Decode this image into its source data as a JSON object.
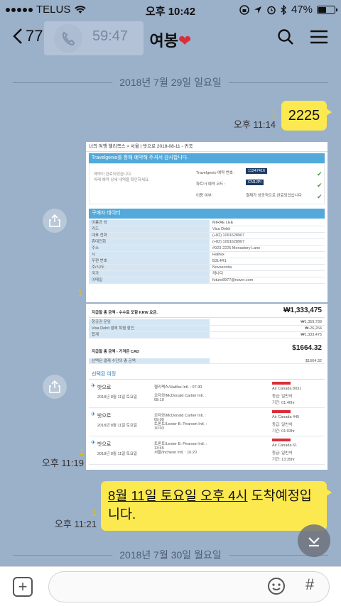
{
  "status_bar": {
    "carrier": "TELUS",
    "time": "오후 10:42",
    "battery": "47%",
    "battery_level": 0.47
  },
  "header": {
    "back_count": "77",
    "call_timer": "59:47",
    "title": "여봉",
    "title_emoji": "❤️"
  },
  "dates": {
    "first": "2018년 7월 29일 일요일",
    "second": "2018년 7월 30일 월요일"
  },
  "messages": [
    {
      "type": "text",
      "text": "2225",
      "time": "오후 11:14",
      "unread": "1"
    },
    {
      "type": "image",
      "unread": "1",
      "content": {
        "breadcrumb": "너의 여행 헬리콕스 > 서울 | 밧으로 2018-08-11 - 귀국",
        "thanks": "Travelgenio를 통해 예약해 주셔서 감사합니다.",
        "booking_id_label": "Travelgenio 예약 번호 :",
        "booking_id": "11247416",
        "airline_code_label": "파트너 예약 코드 :",
        "airline_code": "CN1JPI",
        "status_label": "이용 여부:",
        "status": "결제가 성공적으로 완료되었습니다",
        "buyer_title": "구매자 데이터",
        "buyer_rows": [
          {
            "k": "이름과 성",
            "v": "MIRAE LEE"
          },
          {
            "k": "카드",
            "v": "Visa Debit"
          },
          {
            "k": "대표 전화",
            "v": "(+82) 1091628907"
          },
          {
            "k": "휴대전화",
            "v": "(+82) 1091628907"
          },
          {
            "k": "주소",
            "v": "#923-2225 Monastery Lane"
          },
          {
            "k": "시",
            "v": "Halifax"
          },
          {
            "k": "우편 번호",
            "v": "B3L4R1"
          },
          {
            "k": "주/시/도",
            "v": "Novascotia"
          },
          {
            "k": "국가",
            "v": "캐나다"
          },
          {
            "k": "이메일",
            "v": "future8977@naver.com"
          }
        ]
      }
    },
    {
      "type": "image",
      "time": "오후 11:19",
      "unread": "1",
      "content": {
        "total_krw_label": "지급할 총 금액 - 수수료 포함 KRW 요금.",
        "total_krw": "₩1,333,475",
        "krw_rows": [
          {
            "k": "항공권 운임",
            "v": "₩1,359,739"
          },
          {
            "k": "Visa Debit 결제 특별 할인",
            "v": "₩-26,264"
          },
          {
            "k": "합계",
            "v": "₩1,333,475"
          }
        ],
        "total_cad_label": "지급할 총 금액 - 가격은 CAD",
        "total_cad": "$1664.32",
        "cad_row": {
          "k": "선택된 결제 수단의 총 금액",
          "v": "$1664.32"
        },
        "flights_title": "선택된 여정",
        "flights": [
          {
            "dir": "밧으로",
            "date": "2018년 8월 11일 토요일",
            "from": "헬리팩스/Halifax Intl. : 07:30",
            "to": "오타와/McDonald Cartier Intl. : 08:10",
            "airline": "Air Canada 8031",
            "cls": "등급: 일반석",
            "dur": "기간: 01:40hr"
          },
          {
            "dir": "밧으로",
            "date": "2018년 8월 11일 토요일",
            "from": "오타와/McDonald Cartier Intl. : 09:00",
            "to": "토론토/Lester B. Pearson Intl. : 10:03",
            "airline": "Air Canada 445",
            "cls": "등급: 일반석",
            "dur": "기간: 01:03hr"
          },
          {
            "dir": "밧으로",
            "date": "2018년 8월 11일 토요일",
            "from": "토론토/Lester B. Pearson Intl. : 13:45",
            "to": "서울/Incheon Intl. : 16:20",
            "airline": "Air Canada 61",
            "cls": "등급: 일반석",
            "dur": "기간: 13:35hr"
          }
        ]
      }
    },
    {
      "type": "text",
      "text_underlined": "8월 11일 토요일 오후 4시",
      "text_rest": " 도착예정입니다.",
      "time": "오후 11:21",
      "unread": "1"
    }
  ],
  "input": {
    "placeholder": ""
  }
}
